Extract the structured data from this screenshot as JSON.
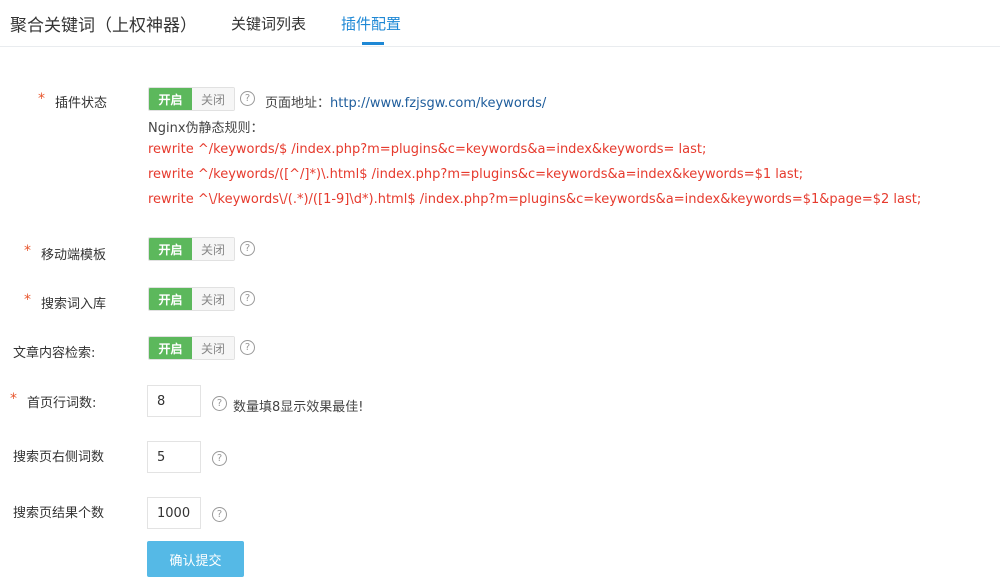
{
  "header": {
    "title": "聚合关键词（上权神器）",
    "tabs": [
      {
        "label": "关键词列表",
        "active": false
      },
      {
        "label": "插件配置",
        "active": true
      }
    ]
  },
  "form": {
    "plugin_status": {
      "label": "插件状态",
      "on": "开启",
      "off": "关闭",
      "page_url_label": "页面地址：",
      "page_url": "http://www.fzjsgw.com/keywords/",
      "nginx_label": "Nginx伪静态规则：",
      "rules": [
        "rewrite ^/keywords/$ /index.php?m=plugins&c=keywords&a=index&keywords= last;",
        "rewrite ^/keywords/([^/]*)\\.html$ /index.php?m=plugins&c=keywords&a=index&keywords=$1 last;",
        "rewrite ^\\/keywords\\/(.*)/([1-9]\\d*).html$ /index.php?m=plugins&c=keywords&a=index&keywords=$1&page=$2 last;"
      ]
    },
    "mobile_template": {
      "label": "移动端模板",
      "on": "开启",
      "off": "关闭"
    },
    "search_into_db": {
      "label": "搜索词入库",
      "on": "开启",
      "off": "关闭"
    },
    "article_search": {
      "label": "文章内容检索:",
      "on": "开启",
      "off": "关闭"
    },
    "home_row_count": {
      "label": "首页行词数:",
      "value": "8",
      "hint": "数量填8显示效果最佳!"
    },
    "search_right_count": {
      "label": "搜索页右侧词数",
      "value": "5"
    },
    "search_result_count": {
      "label": "搜索页结果个数",
      "value": "1000"
    },
    "submit_label": "确认提交",
    "required_mark": "*",
    "help_glyph": "?"
  },
  "colors": {
    "accent": "#1e88d5",
    "toggle_on": "#5cb85c",
    "rule_text": "#e63a2d",
    "submit": "#55b9e6",
    "required": "#e8562d"
  }
}
